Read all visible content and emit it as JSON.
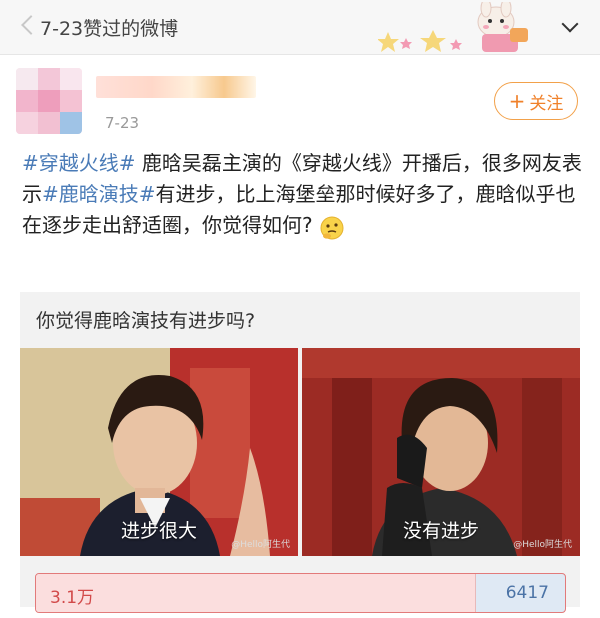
{
  "header": {
    "title": "7-23赞过的微博",
    "back_icon": "chevron-left-icon",
    "more_icon": "chevron-down-icon"
  },
  "post": {
    "username": "",
    "time": "7-23",
    "follow_label": "关注",
    "text": {
      "topic1": "#穿越火线#",
      "seg1": " 鹿晗吴磊主演的《穿越火线》开播后，很多网友表示",
      "topic2": "#鹿晗演技#",
      "seg2": "有进步，比上海堡垒那时候好多了，鹿晗似乎也在逐步走出舒适圈，你觉得如何?",
      "emoji": "thinking-emoji"
    }
  },
  "poll": {
    "question": "你觉得鹿晗演技有进步吗?",
    "options": [
      {
        "label": "进步很大",
        "watermark": "@Hello阿生代"
      },
      {
        "label": "没有进步",
        "watermark": "@Hello阿生代"
      }
    ],
    "result_left": "3.1万",
    "result_right": "6417",
    "left_share": 0.83,
    "colors": {
      "left": "#fbdede",
      "right": "#dfe9f4",
      "accent": "#f0812a",
      "topic": "#4a7bb7"
    }
  }
}
